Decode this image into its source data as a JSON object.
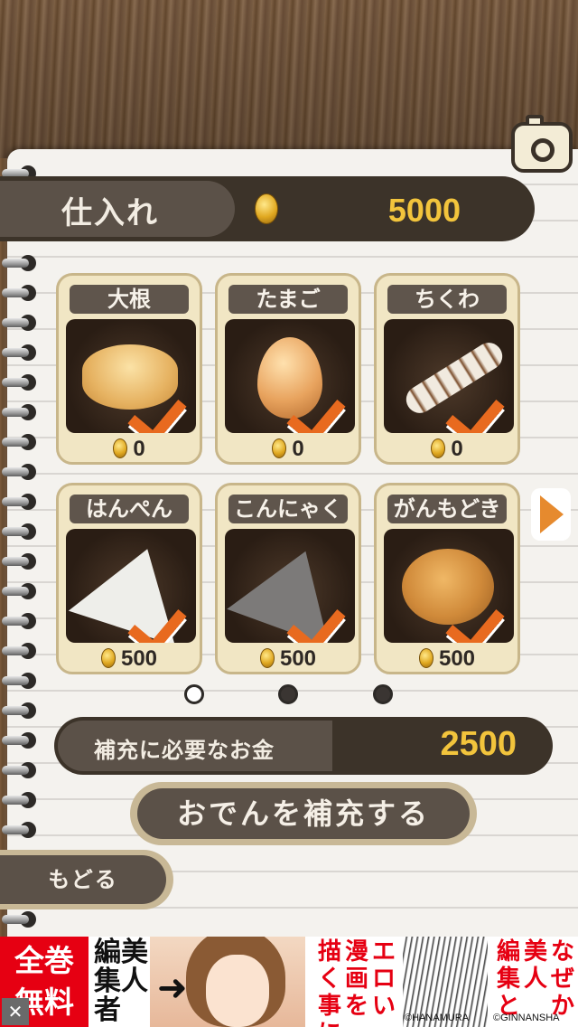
{
  "header": {
    "title": "仕入れ",
    "money": "5000"
  },
  "items": [
    {
      "name": "大根",
      "price": "0",
      "icon": "daikon-icon"
    },
    {
      "name": "たまご",
      "price": "0",
      "icon": "egg-icon"
    },
    {
      "name": "ちくわ",
      "price": "0",
      "icon": "chikuwa-icon"
    },
    {
      "name": "はんぺん",
      "price": "500",
      "icon": "hanpen-icon"
    },
    {
      "name": "こんにゃく",
      "price": "500",
      "icon": "konnyaku-icon"
    },
    {
      "name": "がんもどき",
      "price": "500",
      "icon": "ganmodoki-icon"
    }
  ],
  "pagination": {
    "current": 1,
    "total": 3
  },
  "summary": {
    "label": "補充に必要なお金",
    "money": "2500"
  },
  "buttons": {
    "refill": "おでんを補充する",
    "back": "もどる"
  },
  "ad": {
    "badge_line1": "全巻",
    "badge_line2": "無料",
    "left_text": "編美集人者",
    "col1": "描く事に",
    "col2": "漫画を",
    "col3": "エロい",
    "col4": "編集と",
    "col5": "美人",
    "col6": "なぜか",
    "credit1": "©HANAMURA",
    "credit2": "©GINNANSHA"
  },
  "colors": {
    "accent": "#f2c43c",
    "bar_dark": "#3c3329",
    "check": "#e86a1f"
  }
}
